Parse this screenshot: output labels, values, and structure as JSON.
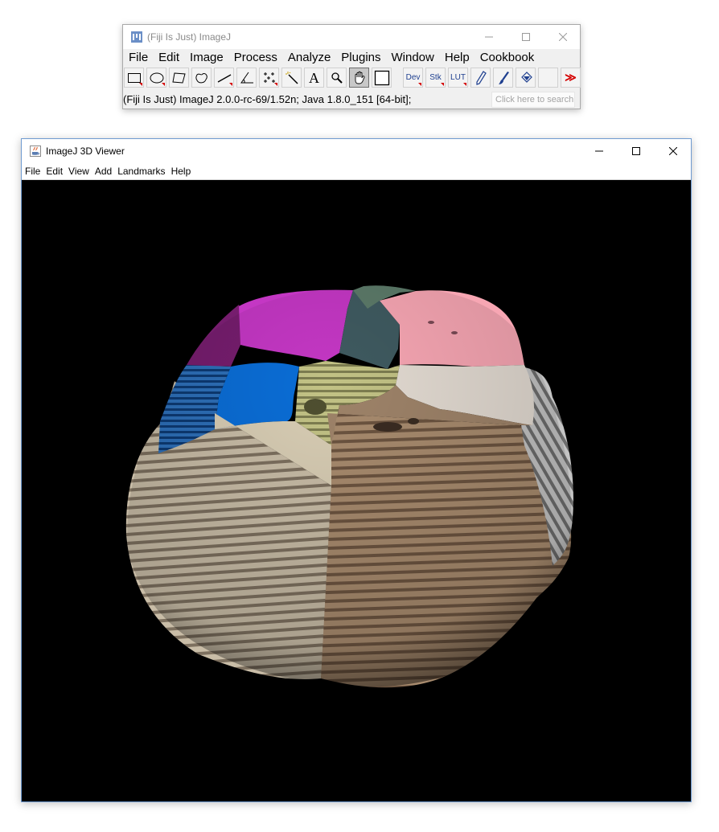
{
  "fiji": {
    "title": "(Fiji Is Just) ImageJ",
    "menus": [
      "File",
      "Edit",
      "Image",
      "Process",
      "Analyze",
      "Plugins",
      "Window",
      "Help",
      "Cookbook"
    ],
    "tools": [
      "rectangle-tool",
      "oval-tool",
      "polygon-tool",
      "freehand-tool",
      "line-tool",
      "angle-tool",
      "point-tool",
      "wand-tool",
      "text-tool",
      "magnifying-glass-tool",
      "hand-tool",
      "color-picker-tool",
      "dev-menu",
      "stk-menu",
      "lut-menu",
      "pencil-tool",
      "brush-tool",
      "flood-fill-tool",
      "empty-slot",
      "more-tools"
    ],
    "tool_labels": {
      "dev": "Dev",
      "stk": "Stk",
      "lut": "LUT",
      "text": "A",
      "more": "≫"
    },
    "status": "(Fiji Is Just) ImageJ 2.0.0-rc-69/1.52n; Java 1.8.0_151 [64-bit];",
    "search_placeholder": "Click here to search",
    "active_tool": "hand-tool",
    "colors": {
      "accent_red": "#d40000",
      "tool_text_blue": "#1e3f8f"
    }
  },
  "viewer": {
    "title": "ImageJ 3D Viewer",
    "menus": [
      "File",
      "Edit",
      "View",
      "Add",
      "Landmarks",
      "Help"
    ],
    "canvas_background": "#000000",
    "region_colors": [
      "#c437c4",
      "#f7a6b3",
      "#5c7a69",
      "#3f5a60",
      "#0a6dd6",
      "#0b4fa8",
      "#7a1d73",
      "#b5b57c",
      "#e3dbd2",
      "#d8cdb4",
      "#9e8369",
      "#b9a99a"
    ]
  }
}
